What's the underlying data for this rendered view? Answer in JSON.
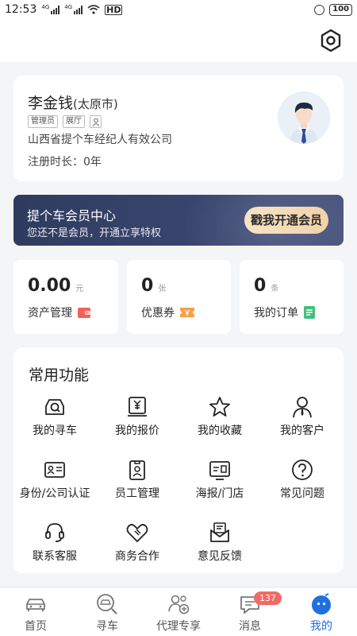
{
  "status_bar": {
    "time": "12:53",
    "signal1": "4G",
    "signal2": "4G",
    "network": "HD",
    "battery": "100"
  },
  "profile": {
    "name": "李金钱",
    "city": "(太原市)",
    "tags": [
      "管理员",
      "展厅"
    ],
    "company": "山西省提个车经纪人有效公司",
    "register_label": "注册时长：",
    "register_value": "0年"
  },
  "member": {
    "title": "提个车会员中心",
    "subtitle": "您还不是会员，开通立享特权",
    "button": "戳我开通会员"
  },
  "stats": [
    {
      "value": "0.00",
      "unit": "元",
      "label": "资产管理",
      "icon": "wallet-icon",
      "color": "#f2625a"
    },
    {
      "value": "0",
      "unit": "张",
      "label": "优惠券",
      "icon": "coupon-icon",
      "color": "#f5a04a"
    },
    {
      "value": "0",
      "unit": "条",
      "label": "我的订单",
      "icon": "order-icon",
      "color": "#3fc27a"
    }
  ],
  "functions": {
    "title": "常用功能",
    "items": [
      {
        "label": "我的寻车",
        "icon": "car-search-icon"
      },
      {
        "label": "我的报价",
        "icon": "quote-icon"
      },
      {
        "label": "我的收藏",
        "icon": "star-icon"
      },
      {
        "label": "我的客户",
        "icon": "customer-icon"
      },
      {
        "label": "身份/公司认证",
        "icon": "id-card-icon"
      },
      {
        "label": "员工管理",
        "icon": "badge-icon"
      },
      {
        "label": "海报/门店",
        "icon": "poster-icon"
      },
      {
        "label": "常见问题",
        "icon": "question-icon"
      },
      {
        "label": "联系客服",
        "icon": "headset-icon"
      },
      {
        "label": "商务合作",
        "icon": "handshake-icon"
      },
      {
        "label": "意见反馈",
        "icon": "feedback-icon"
      }
    ]
  },
  "tabs": [
    {
      "label": "首页",
      "icon": "home-car-icon"
    },
    {
      "label": "寻车",
      "icon": "search-car-icon"
    },
    {
      "label": "代理专享",
      "icon": "agent-icon"
    },
    {
      "label": "消息",
      "icon": "message-icon",
      "badge": "137"
    },
    {
      "label": "我的",
      "icon": "profile-icon",
      "active": true
    }
  ],
  "colors": {
    "accent": "#1f6fe0",
    "badge": "#f26a63",
    "banner": "#3a4670",
    "member_button": "#f1d2a8"
  }
}
